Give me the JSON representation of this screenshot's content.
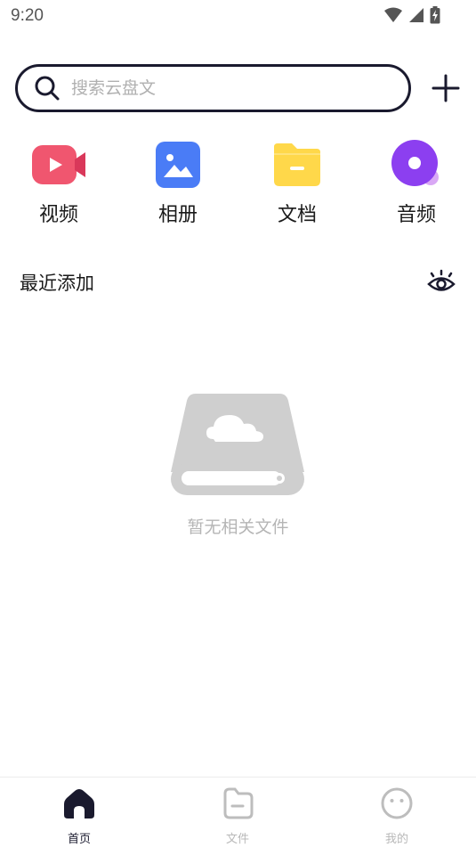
{
  "status_bar": {
    "time": "9:20",
    "icons": [
      "wifi-icon",
      "signal-icon",
      "battery-charging-icon"
    ]
  },
  "search": {
    "placeholder": "搜索云盘文",
    "icon": "search-icon"
  },
  "add_button": {
    "icon": "plus-icon"
  },
  "categories": [
    {
      "label": "视频",
      "icon": "video-icon",
      "color": "#f0566f"
    },
    {
      "label": "相册",
      "icon": "album-icon",
      "color": "#4a7cf6"
    },
    {
      "label": "文档",
      "icon": "document-folder-icon",
      "color": "#ffd84a"
    },
    {
      "label": "音频",
      "icon": "audio-disc-icon",
      "color": "#8c3ff0"
    }
  ],
  "recent": {
    "title": "最近添加",
    "visibility_icon": "eye-icon"
  },
  "empty_state": {
    "icon": "cloud-drive-icon",
    "text": "暂无相关文件"
  },
  "bottom_nav": [
    {
      "label": "首页",
      "icon": "home-icon",
      "active": true
    },
    {
      "label": "文件",
      "icon": "file-icon",
      "active": false
    },
    {
      "label": "我的",
      "icon": "smiley-icon",
      "active": false
    }
  ],
  "colors": {
    "accent": "#1a1a2e",
    "inactive": "#b8b8b8",
    "placeholder": "#b0b0b0"
  }
}
